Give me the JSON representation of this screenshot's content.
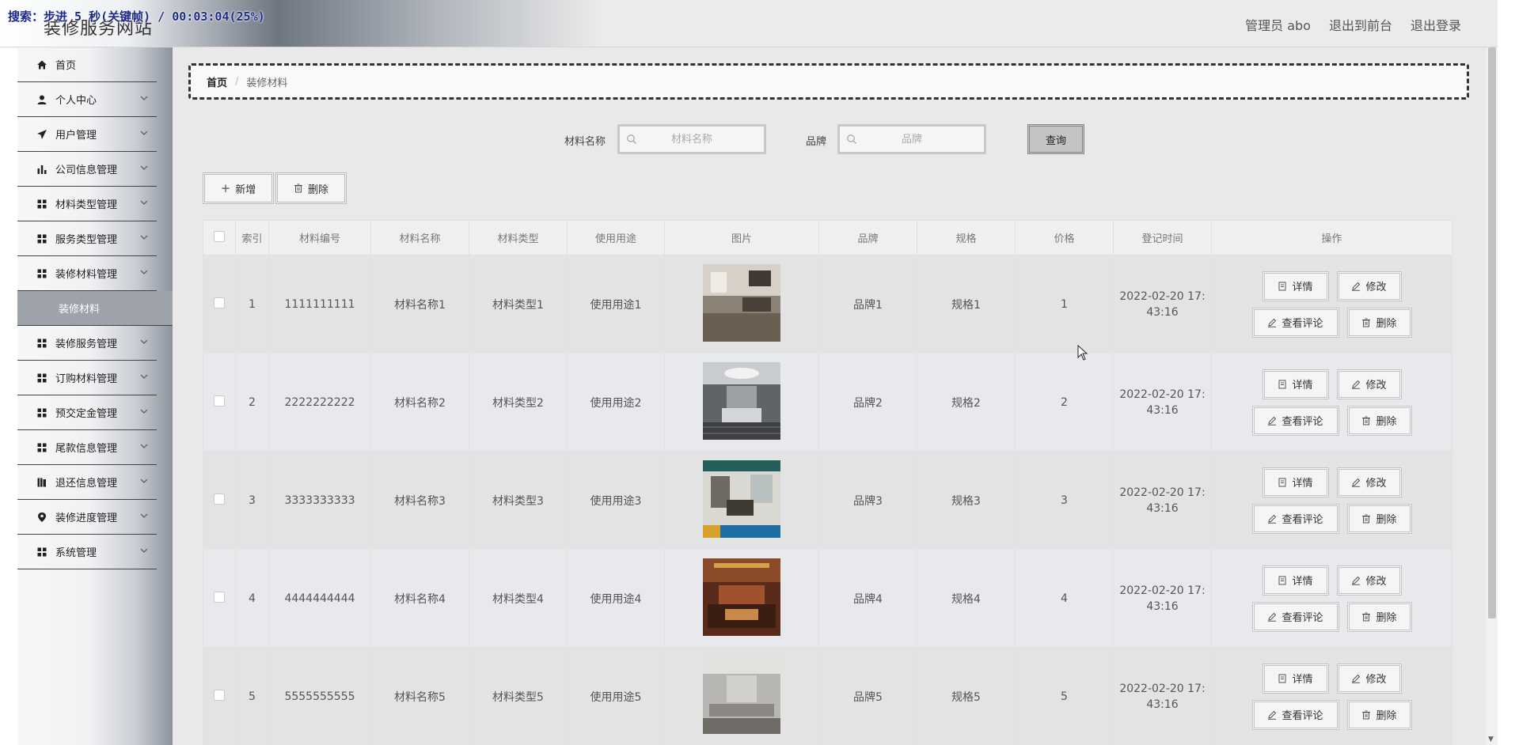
{
  "overlay": "搜索：步进 5 秒(关键帧) / 00:03:04(25%)",
  "site": {
    "title": "装修服务网站"
  },
  "top_links": [
    "管理员 abo",
    "退出到前台",
    "退出登录"
  ],
  "sidebar": {
    "items": [
      {
        "label": "首页",
        "icon": "home-icon",
        "chevron": false
      },
      {
        "label": "个人中心",
        "icon": "user-icon",
        "chevron": true
      },
      {
        "label": "用户管理",
        "icon": "send-icon",
        "chevron": true
      },
      {
        "label": "公司信息管理",
        "icon": "bar-chart-icon",
        "chevron": true
      },
      {
        "label": "材料类型管理",
        "icon": "grid-icon",
        "chevron": true
      },
      {
        "label": "服务类型管理",
        "icon": "grid-icon",
        "chevron": true
      },
      {
        "label": "装修材料管理",
        "icon": "grid-icon",
        "chevron": true
      }
    ],
    "active_sub": "装修材料",
    "items_after": [
      {
        "label": "装修服务管理",
        "icon": "grid-icon",
        "chevron": true
      },
      {
        "label": "订购材料管理",
        "icon": "grid-icon",
        "chevron": true
      },
      {
        "label": "预交定金管理",
        "icon": "grid-icon",
        "chevron": true
      },
      {
        "label": "尾款信息管理",
        "icon": "grid-icon",
        "chevron": true
      },
      {
        "label": "退还信息管理",
        "icon": "library-icon",
        "chevron": true
      },
      {
        "label": "装修进度管理",
        "icon": "location-icon",
        "chevron": true
      },
      {
        "label": "系统管理",
        "icon": "grid-icon",
        "chevron": true
      }
    ]
  },
  "breadcrumb": {
    "home": "首页",
    "sep": "/",
    "current": "装修材料"
  },
  "search": {
    "name_label": "材料名称",
    "name_placeholder": "材料名称",
    "brand_label": "品牌",
    "brand_placeholder": "品牌",
    "query_label": "查询"
  },
  "actions": {
    "add_label": "新增",
    "delete_label": "删除"
  },
  "table": {
    "headers": [
      "",
      "索引",
      "材料编号",
      "材料名称",
      "材料类型",
      "使用用途",
      "图片",
      "品牌",
      "规格",
      "价格",
      "登记时间",
      "操作"
    ],
    "rows": [
      {
        "index": "1",
        "code": "1111111111",
        "name": "材料名称1",
        "type": "材料类型1",
        "usage": "使用用途1",
        "brand": "品牌1",
        "spec": "规格1",
        "price": "1",
        "time_a": "2022-02-20 17:",
        "time_b": "43:16"
      },
      {
        "index": "2",
        "code": "2222222222",
        "name": "材料名称2",
        "type": "材料类型2",
        "usage": "使用用途2",
        "brand": "品牌2",
        "spec": "规格2",
        "price": "2",
        "time_a": "2022-02-20 17:",
        "time_b": "43:16"
      },
      {
        "index": "3",
        "code": "3333333333",
        "name": "材料名称3",
        "type": "材料类型3",
        "usage": "使用用途3",
        "brand": "品牌3",
        "spec": "规格3",
        "price": "3",
        "time_a": "2022-02-20 17:",
        "time_b": "43:16"
      },
      {
        "index": "4",
        "code": "4444444444",
        "name": "材料名称4",
        "type": "材料类型4",
        "usage": "使用用途4",
        "brand": "品牌4",
        "spec": "规格4",
        "price": "4",
        "time_a": "2022-02-20 17:",
        "time_b": "43:16"
      },
      {
        "index": "5",
        "code": "5555555555",
        "name": "材料名称5",
        "type": "材料类型5",
        "usage": "使用用途5",
        "brand": "品牌5",
        "spec": "规格5",
        "price": "5",
        "time_a": "2022-02-20 17:",
        "time_b": "43:16"
      }
    ],
    "ops": {
      "detail": "详情",
      "edit": "修改",
      "comments": "查看评论",
      "delete": "删除"
    }
  }
}
